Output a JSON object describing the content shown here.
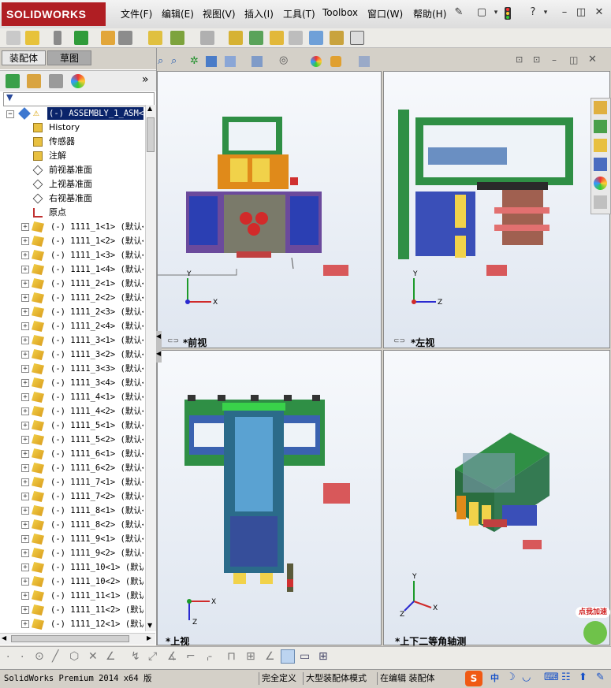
{
  "app": {
    "logo_text": "SOLIDWORKS",
    "menu": [
      "文件(F)",
      "编辑(E)",
      "视图(V)",
      "插入(I)",
      "工具(T)",
      "Toolbox",
      "窗口(W)",
      "帮助(H)"
    ]
  },
  "panel": {
    "tabs": [
      "装配体",
      "草图"
    ],
    "root": "(-) ASSEMBLY_1_ASM<1",
    "items": [
      {
        "label": "History",
        "icon": "history-icon"
      },
      {
        "label": "传感器",
        "icon": "sensor-icon"
      },
      {
        "label": "注解",
        "icon": "annotation-icon"
      },
      {
        "label": "前视基准面",
        "icon": "plane-icon"
      },
      {
        "label": "上视基准面",
        "icon": "plane-icon"
      },
      {
        "label": "右视基准面",
        "icon": "plane-icon"
      },
      {
        "label": "原点",
        "icon": "origin-icon"
      }
    ],
    "parts": [
      "(-) 1111_1<1> (默认<",
      "(-) 1111_1<2> (默认<",
      "(-) 1111_1<3> (默认<",
      "(-) 1111_1<4> (默认<",
      "(-) 1111_2<1> (默认<",
      "(-) 1111_2<2> (默认<",
      "(-) 1111_2<3> (默认<",
      "(-) 1111_2<4> (默认<",
      "(-) 1111_3<1> (默认<",
      "(-) 1111_3<2> (默认<",
      "(-) 1111_3<3> (默认<",
      "(-) 1111_3<4> (默认<",
      "(-) 1111_4<1> (默认<",
      "(-) 1111_4<2> (默认<",
      "(-) 1111_5<1> (默认<",
      "(-) 1111_5<2> (默认<",
      "(-) 1111_6<1> (默认<",
      "(-) 1111_6<2> (默认<",
      "(-) 1111_7<1> (默认<",
      "(-) 1111_7<2> (默认<",
      "(-) 1111_8<1> (默认<",
      "(-) 1111_8<2> (默认<",
      "(-) 1111_9<1> (默认<",
      "(-) 1111_9<2> (默认<",
      "(-) 1111_10<1> (默认",
      "(-) 1111_10<2> (默认",
      "(-) 1111_11<1> (默认",
      "(-) 1111_11<2> (默认",
      "(-) 1111_12<1> (默认"
    ]
  },
  "viewports": {
    "front": "*前视",
    "left": "*左视",
    "top": "*上视",
    "iso": "*上下二等角轴测"
  },
  "axes": {
    "x": "X",
    "y": "Y",
    "z": "Z"
  },
  "status": {
    "version": "SolidWorks Premium 2014 x64 版",
    "fully_defined": "完全定义",
    "mode": "大型装配体模式",
    "editing": "在编辑 装配体",
    "ime_lang": "中",
    "ime_badge": "点我加速"
  }
}
